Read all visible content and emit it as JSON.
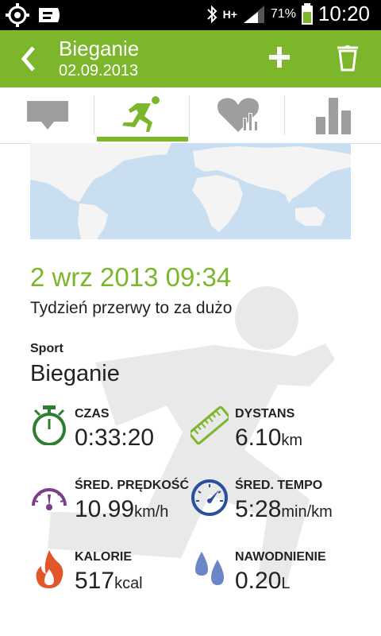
{
  "status_bar": {
    "battery": "71%",
    "time": "10:20",
    "network": "H+"
  },
  "action_bar": {
    "title": "Bieganie",
    "subtitle": "02.09.2013"
  },
  "tabs": [
    "comments",
    "workout",
    "heart-rate",
    "stats"
  ],
  "workout": {
    "datetime": "2 wrz 2013 09:34",
    "motto": "Tydzień przerwy to za dużo",
    "sport_label": "Sport",
    "sport_value": "Bieganie",
    "stats": [
      {
        "label": "CZAS",
        "value": "0:33:20",
        "unit": ""
      },
      {
        "label": "DYSTANS",
        "value": "6.10",
        "unit": "km"
      },
      {
        "label": "ŚRED. PRĘDKOŚĆ",
        "value": "10.99",
        "unit": "km/h"
      },
      {
        "label": "ŚRED. TEMPO",
        "value": "5:28",
        "unit": "min/km"
      },
      {
        "label": "KALORIE",
        "value": "517",
        "unit": "kcal"
      },
      {
        "label": "NAWODNIENIE",
        "value": "0.20",
        "unit": "L"
      }
    ]
  },
  "colors": {
    "accent": "#7cb62a",
    "stopwatch": "#2e7d32",
    "speed": "#7b3f8a",
    "pace": "#2a4fa0",
    "flame": "#e2562a",
    "water": "#6b86c7"
  }
}
